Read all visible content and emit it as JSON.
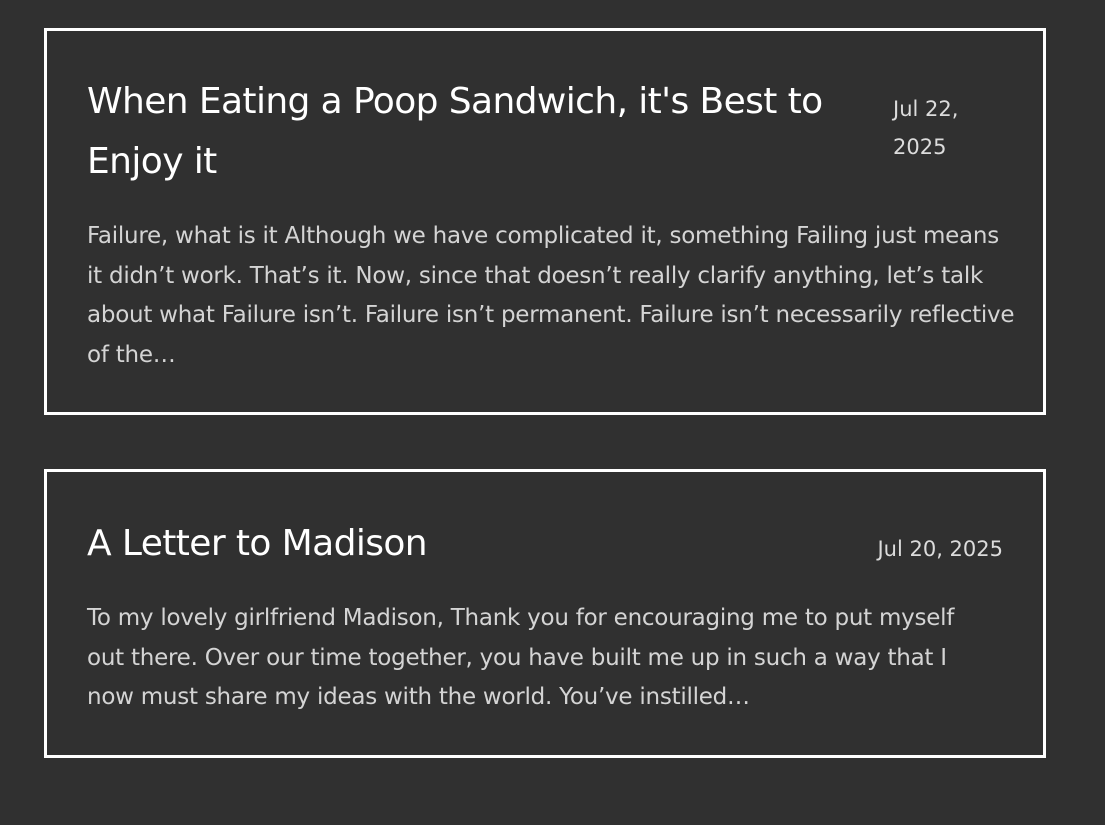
{
  "posts": [
    {
      "title": "When Eating a Poop Sandwich, it's Best to Enjoy it",
      "date": "Jul 22, 2025",
      "excerpt": "Failure, what is it Although we have complicated it, something Failing just means it didn’t work. That’s it. Now, since that doesn’t really clarify anything, let’s talk about what Failure isn’t. Failure isn’t permanent. Failure isn’t necessarily reflective of the…"
    },
    {
      "title": "A Letter to Madison",
      "date": "Jul 20, 2025",
      "excerpt": "To my lovely girlfriend Madison, Thank you for encouraging me to put myself out there. Over our time together, you have built me up in such a way that I now must share my ideas with the world. You’ve instilled…"
    }
  ],
  "colors": {
    "background": "#303030",
    "border": "#ffffff",
    "title": "#ffffff",
    "text": "#d4d4d4"
  }
}
